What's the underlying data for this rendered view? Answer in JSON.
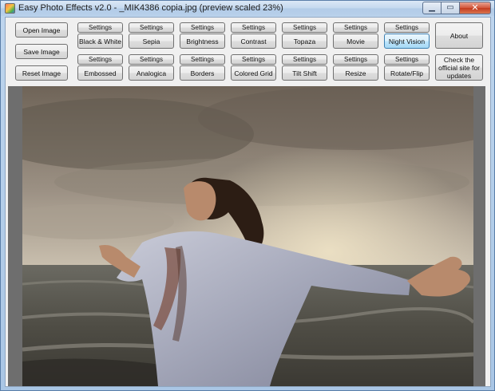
{
  "window": {
    "title": "Easy Photo Effects v2.0 - _MIK4386 copia.jpg (preview scaled 23%)",
    "minimize_glyph": "▁",
    "maximize_glyph": "▭",
    "close_glyph": "✕"
  },
  "left_buttons": {
    "open": "Open Image",
    "save": "Save Image",
    "reset": "Reset Image"
  },
  "settings_label": "Settings",
  "effects_row1": [
    "Black & White",
    "Sepia",
    "Brightness",
    "Contrast",
    "Topaza",
    "Movie",
    "Night Vision"
  ],
  "effects_row2": [
    "Embossed",
    "Analogica",
    "Borders",
    "Colored Grid",
    "Tilt Shift",
    "Resize",
    "Rotate/Flip"
  ],
  "right_buttons": {
    "about": "About",
    "check_updates": "Check the official site for updates"
  },
  "colors": {
    "highlight_button": "#bee6fd",
    "preview_background": "#6e6e6e"
  },
  "icons": {
    "app": "app-icon",
    "minimize": "minimize-icon",
    "maximize": "maximize-icon",
    "close": "close-icon"
  }
}
